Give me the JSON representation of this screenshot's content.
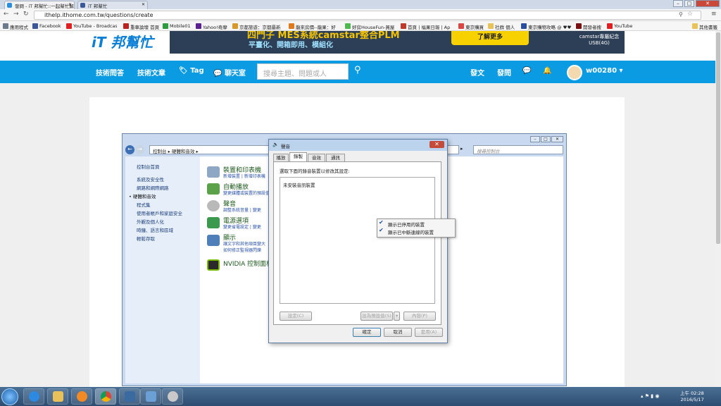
{
  "browser": {
    "tabs": [
      {
        "label": "發問 - iT 邦幫忙::一起幫忙解決難題...",
        "active": true
      },
      {
        "label": "iT 邦幫忙",
        "active": false
      }
    ],
    "url": "ithelp.ithome.com.tw/questions/create",
    "bookmarks": [
      "應用程式",
      "Facebook",
      "YouTube - Broadcast",
      "重車論壇 首頁",
      "Mobile01",
      "Yahoo!奇摩",
      "京都旅遊：京都最新",
      "龍來房價--龍果：好",
      "好房HouseFun-買屋",
      "首頁 | 福果日報 | Ap",
      "東京購買",
      "社群 個人",
      "東京購物攻略 @ ♥♥♥",
      "開發者搜",
      "YouTube"
    ],
    "other_bookmarks": "其他書籤"
  },
  "site": {
    "logo": "iT 邦幫忙",
    "banner": {
      "headline": "四門子 MES系統camstar整合PLM",
      "sub": "平臺化、開箱即用、模組化",
      "cta": "了解更多",
      "ad_text": "camstar專屬紀念USB(4G)"
    },
    "nav": [
      "技術問答",
      "技術文章",
      "Tag",
      "聊天室"
    ],
    "search_placeholder": "搜尋主題、問題或人",
    "right_nav": [
      "發文",
      "發問"
    ],
    "username": "w00280"
  },
  "control_panel": {
    "breadcrumb": "控制台 ▸ 硬體和音效 ▸",
    "search_placeholder": "搜尋控制台",
    "sidebar": [
      "控制台首頁",
      "系統及安全性",
      "網路和網際網路",
      "硬體和音效",
      "程式集",
      "使用者帳戶和家庭安全",
      "外觀及個人化",
      "時鐘、語言和區域",
      "輕鬆存取"
    ],
    "categories": [
      {
        "title": "裝置和印表機",
        "links": "新增裝置 | 新增印表機"
      },
      {
        "title": "自動播放",
        "links": "變更媒體或裝置的預設值"
      },
      {
        "title": "聲音",
        "links": "調整系統音量 | 變更"
      },
      {
        "title": "電源選項",
        "links": "變更省電設定 | 變更"
      },
      {
        "title": "顯示",
        "links": "讓文字和其他項目變大"
      },
      {
        "title": "NVIDIA 控制面板",
        "links": ""
      }
    ],
    "display_sub2": "如何修正監視器閃爍"
  },
  "sound_dialog": {
    "title": "聲音",
    "tabs": [
      "播放",
      "錄製",
      "音效",
      "通訊"
    ],
    "active_tab": 1,
    "instruction": "選取下面的錄音裝置以修改其設定:",
    "empty_text": "未安裝音訊裝置",
    "buttons": {
      "configure": "設定(C)",
      "set_default": "設為預設值(S)",
      "properties": "內容(P)",
      "ok": "確定",
      "cancel": "取消",
      "apply": "套用(A)"
    }
  },
  "context_menu": [
    "顯示已停用的裝置",
    "顯示已中斷連線的裝置"
  ],
  "taskbar": {
    "time": "上午 02:28",
    "date": "2016/5/17"
  }
}
